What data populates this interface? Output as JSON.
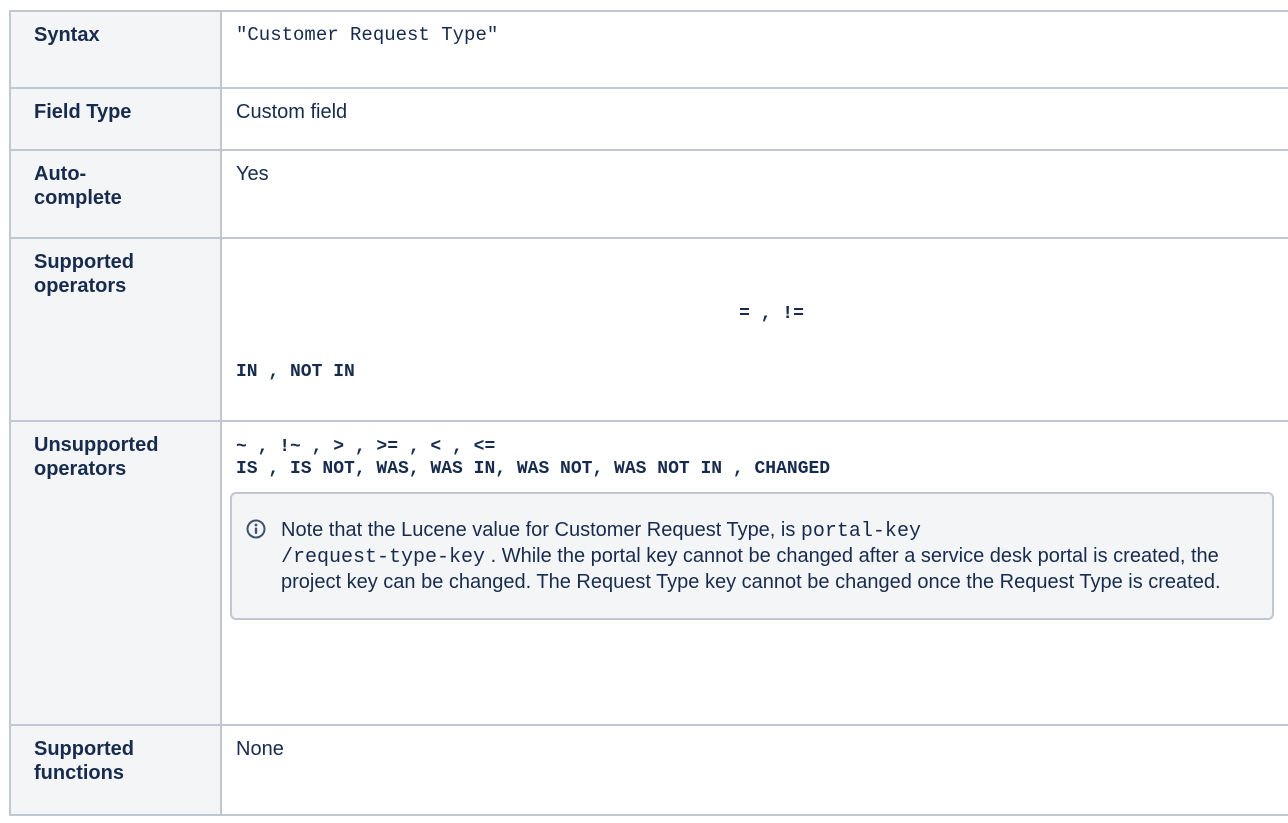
{
  "rows": {
    "syntax": {
      "label": "Syntax",
      "value": "\"Customer Request Type\""
    },
    "field_type": {
      "label": "Field Type",
      "value": "Custom field"
    },
    "autocomplete": {
      "label_line1": "Auto-",
      "label_line2": "complete",
      "value": "Yes"
    },
    "supported_operators": {
      "label_line1": "Supported",
      "label_line2": "operators",
      "line1": "= , !=",
      "line2": "IN , NOT IN"
    },
    "unsupported_operators": {
      "label_line1": "Unsupported",
      "label_line2": "operators",
      "line1": "~ , !~ , > , >= , < , <=",
      "line2": "IS , IS NOT, WAS, WAS IN, WAS NOT, WAS NOT IN , CHANGED",
      "note": {
        "icon": "info-icon",
        "text_before": "Note that the Lucene value for Customer Request Type, is ",
        "code_part1": "portal-key",
        "code_part2": "/request-type-key",
        "text_after": " . While the portal key cannot be changed after a service desk portal is created, the project key can be changed. The Request Type key cannot be changed once the Request Type is created."
      }
    },
    "supported_functions": {
      "label_line1": "Supported",
      "label_line2": "functions",
      "value": "None"
    }
  },
  "colors": {
    "border": "#c1c7d0",
    "label_bg": "#f4f5f7",
    "text": "#172b4d",
    "info_icon": "#42526e"
  }
}
